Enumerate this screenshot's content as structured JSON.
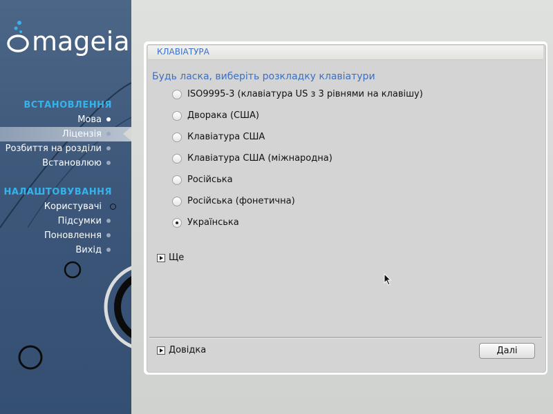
{
  "sidebar": {
    "logo_text": "mageia",
    "sections": [
      {
        "title": "ВСТАНОВЛЕННЯ",
        "items": [
          {
            "label": "Мова",
            "state": "done"
          },
          {
            "label": "Ліцензія",
            "state": "active"
          },
          {
            "label": "Розбиття на розділи",
            "state": "pending"
          },
          {
            "label": "Встановлюю",
            "state": "pending"
          }
        ]
      },
      {
        "title": "НАЛАШТОВУВАННЯ",
        "items": [
          {
            "label": "Користувачі",
            "state": "current"
          },
          {
            "label": "Підсумки",
            "state": "pending"
          },
          {
            "label": "Поновлення",
            "state": "pending"
          },
          {
            "label": "Вихід",
            "state": "pending"
          }
        ]
      }
    ]
  },
  "page": {
    "header": "КЛАВІАТУРА",
    "subtitle": "Будь ласка, виберіть розкладку клавіатури",
    "options": [
      {
        "label": "ISO9995-3 (клавіатура US з 3 рівнями на клавішу)",
        "checked": false
      },
      {
        "label": "Дворака (США)",
        "checked": false
      },
      {
        "label": "Клавіатура США",
        "checked": false
      },
      {
        "label": "Клавіатура США (міжнародна)",
        "checked": false
      },
      {
        "label": "Російська",
        "checked": false
      },
      {
        "label": "Російська (фонетична)",
        "checked": false
      },
      {
        "label": "Українська",
        "checked": true
      }
    ],
    "more_label": "Ще",
    "help_label": "Довідка",
    "next_label": "Далі"
  },
  "colors": {
    "accent": "#35b3ea",
    "link_blue": "#3a6fc4",
    "sidebar_bg": "#3d577a"
  }
}
